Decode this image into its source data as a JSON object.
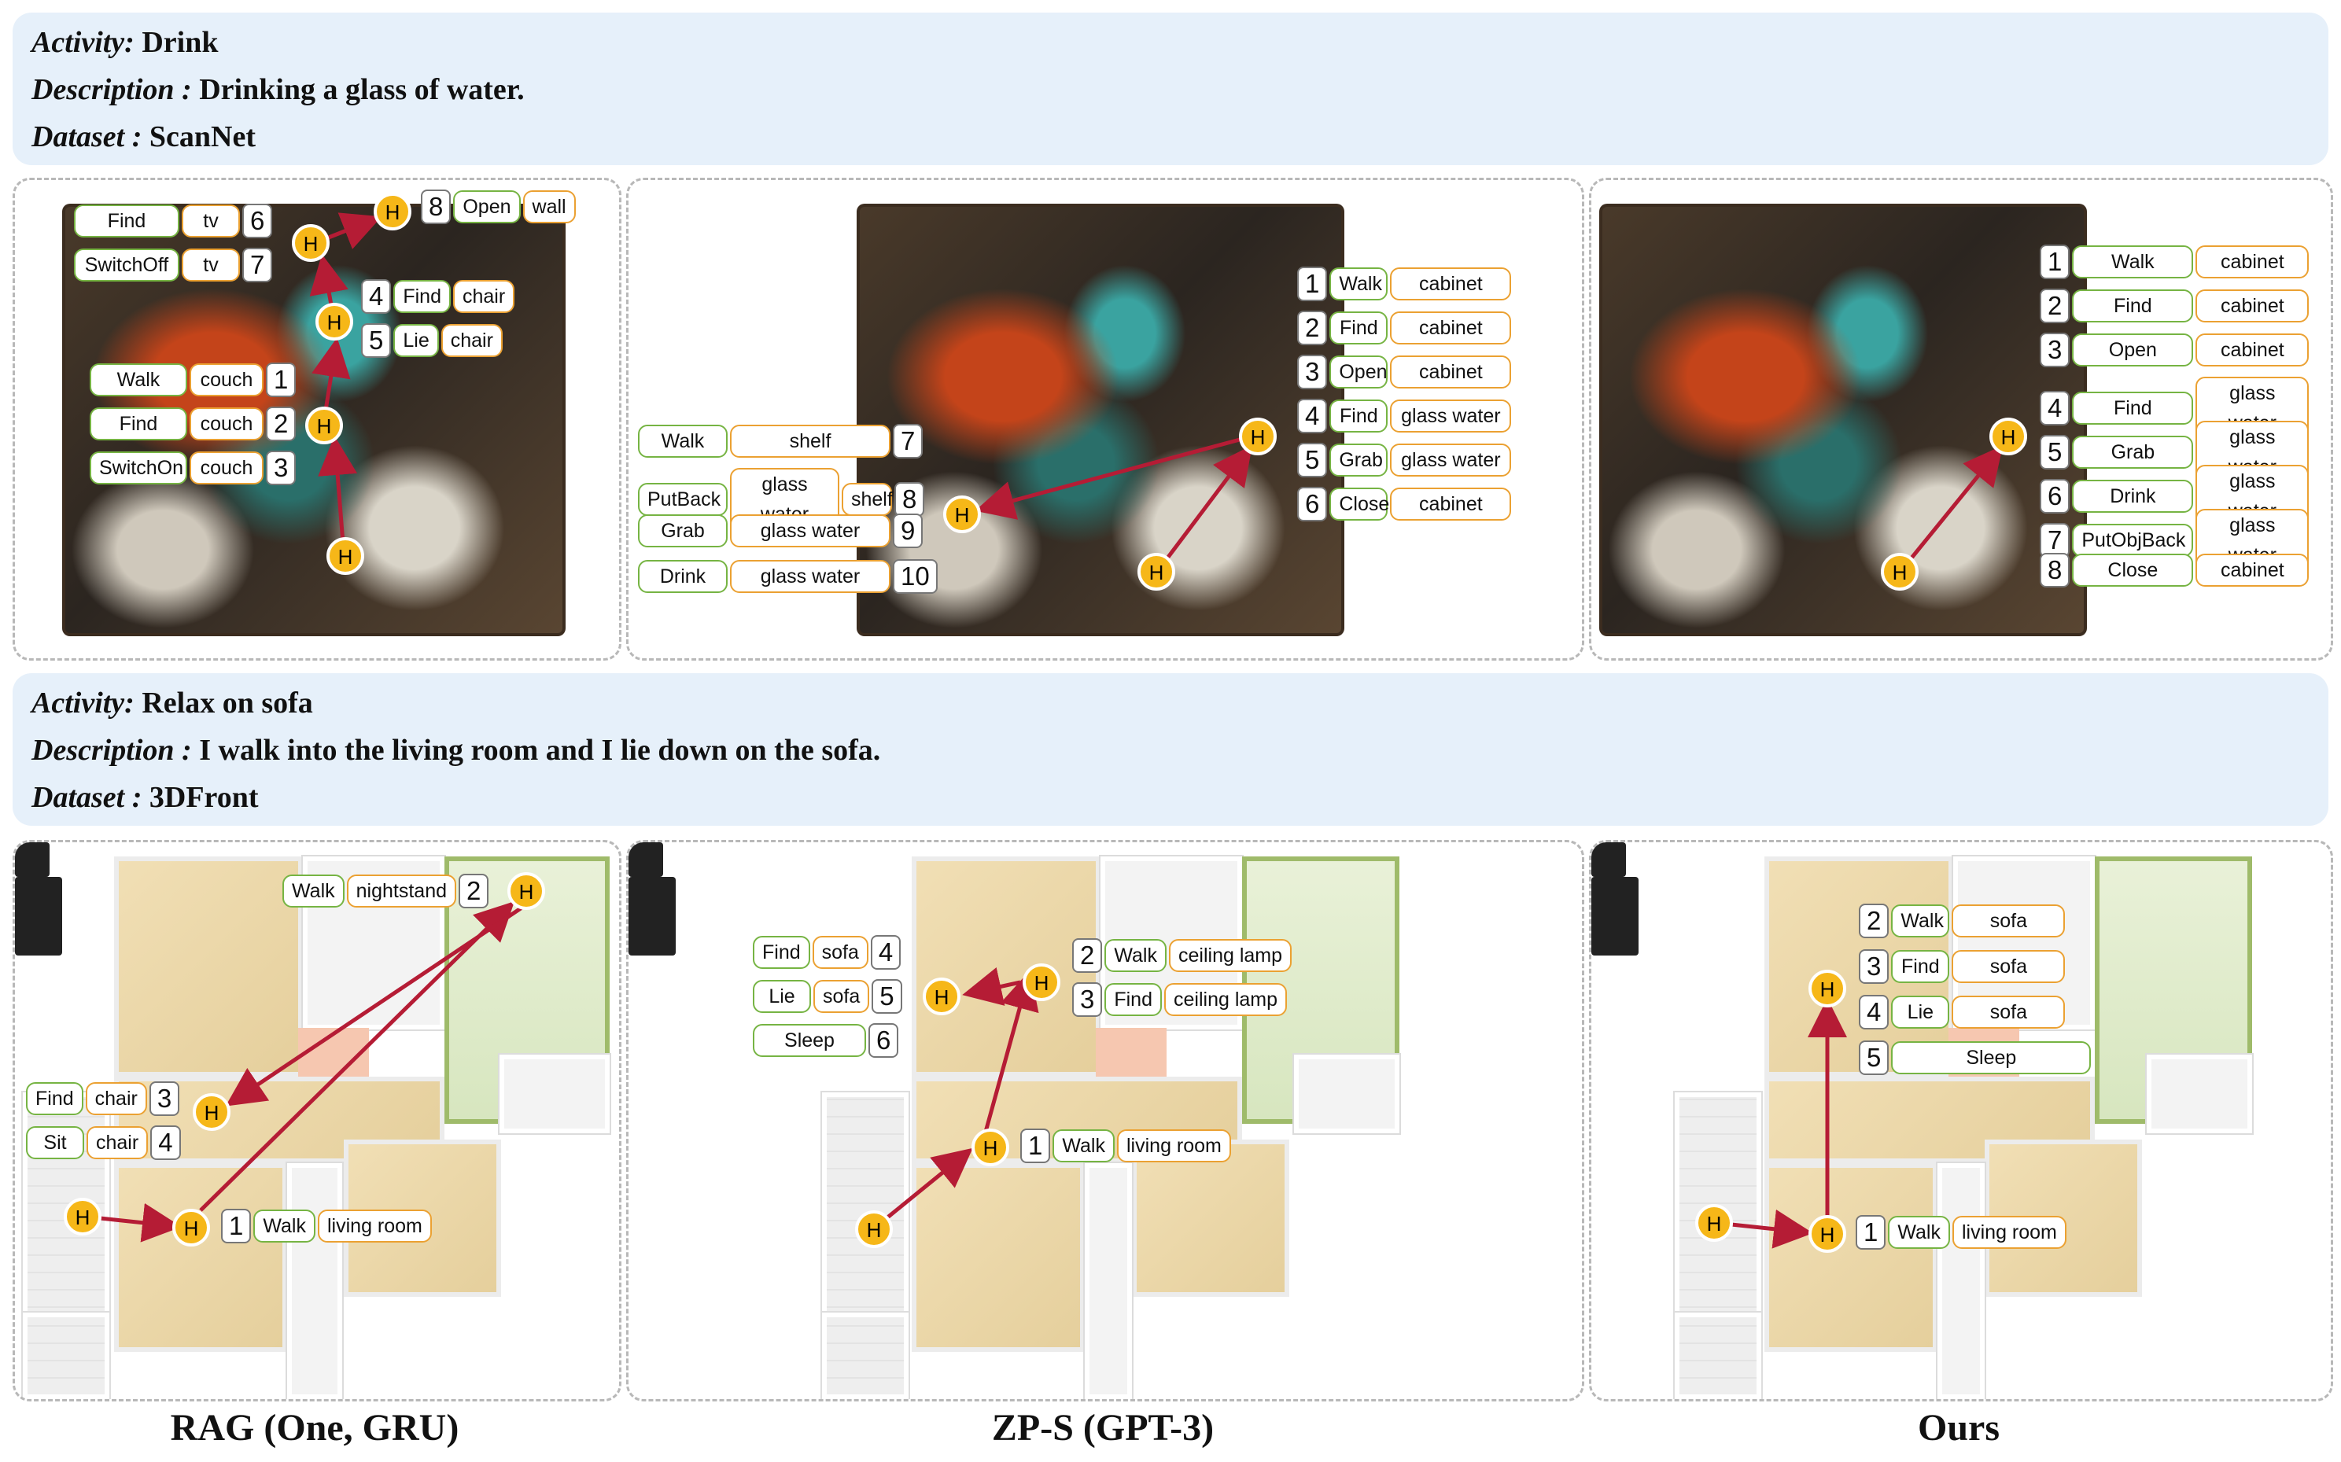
{
  "examples": [
    {
      "activity_label": "Activity:",
      "activity": "Drink",
      "description_label": "Description :",
      "description": "Drinking a glass of water.",
      "dataset_label": "Dataset :",
      "dataset": "ScanNet"
    },
    {
      "activity_label": "Activity:",
      "activity": "Relax on sofa",
      "description_label": "Description :",
      "description": "I walk into the living room and I lie down on the sofa.",
      "dataset_label": "Dataset :",
      "dataset": "3DFront"
    }
  ],
  "node_label": "H",
  "colors": {
    "arrow": "#b51c35",
    "node_fill": "#f6b718",
    "action_border": "#76b443",
    "object_border": "#eba132",
    "header_bg": "#e6f0fa"
  },
  "panels": {
    "scan_rag": {
      "steps": [
        {
          "num": "6",
          "action": "Find",
          "object": "tv"
        },
        {
          "num": "7",
          "action": "SwitchOff",
          "object": "tv"
        },
        {
          "num": "8",
          "action": "Open",
          "object": "wall"
        },
        {
          "num": "4",
          "action": "Find",
          "object": "chair"
        },
        {
          "num": "5",
          "action": "Lie",
          "object": "chair"
        },
        {
          "num": "1",
          "action": "Walk",
          "object": "couch"
        },
        {
          "num": "2",
          "action": "Find",
          "object": "couch"
        },
        {
          "num": "3",
          "action": "SwitchOn",
          "object": "couch"
        }
      ]
    },
    "scan_zps": {
      "steps": [
        {
          "num": "1",
          "action": "Walk",
          "object": "cabinet"
        },
        {
          "num": "2",
          "action": "Find",
          "object": "cabinet"
        },
        {
          "num": "3",
          "action": "Open",
          "object": "cabinet"
        },
        {
          "num": "4",
          "action": "Find",
          "object": "glass water"
        },
        {
          "num": "5",
          "action": "Grab",
          "object": "glass water"
        },
        {
          "num": "6",
          "action": "Close",
          "object": "cabinet"
        },
        {
          "num": "7",
          "action": "Walk",
          "object": "shelf"
        },
        {
          "num": "8",
          "action": "PutBack",
          "object": "glass water",
          "object2": "shelf"
        },
        {
          "num": "9",
          "action": "Grab",
          "object": "glass water"
        },
        {
          "num": "10",
          "action": "Drink",
          "object": "glass water"
        }
      ]
    },
    "scan_ours": {
      "steps": [
        {
          "num": "1",
          "action": "Walk",
          "object": "cabinet"
        },
        {
          "num": "2",
          "action": "Find",
          "object": "cabinet"
        },
        {
          "num": "3",
          "action": "Open",
          "object": "cabinet"
        },
        {
          "num": "4",
          "action": "Find",
          "object": "glass water"
        },
        {
          "num": "5",
          "action": "Grab",
          "object": "glass water"
        },
        {
          "num": "6",
          "action": "Drink",
          "object": "glass water"
        },
        {
          "num": "7",
          "action": "PutObjBack",
          "object": "glass water"
        },
        {
          "num": "8",
          "action": "Close",
          "object": "cabinet"
        }
      ]
    },
    "front_rag": {
      "steps": [
        {
          "num": "2",
          "action": "Walk",
          "object": "nightstand"
        },
        {
          "num": "3",
          "action": "Find",
          "object": "chair"
        },
        {
          "num": "4",
          "action": "Sit",
          "object": "chair"
        },
        {
          "num": "1",
          "action": "Walk",
          "object": "living room"
        }
      ]
    },
    "front_zps": {
      "steps": [
        {
          "num": "4",
          "action": "Find",
          "object": "sofa"
        },
        {
          "num": "5",
          "action": "Lie",
          "object": "sofa"
        },
        {
          "num": "6",
          "action": "Sleep",
          "object": ""
        },
        {
          "num": "2",
          "action": "Walk",
          "object": "ceiling lamp"
        },
        {
          "num": "3",
          "action": "Find",
          "object": "ceiling lamp"
        },
        {
          "num": "1",
          "action": "Walk",
          "object": "living room"
        }
      ]
    },
    "front_ours": {
      "steps": [
        {
          "num": "2",
          "action": "Walk",
          "object": "sofa"
        },
        {
          "num": "3",
          "action": "Find",
          "object": "sofa"
        },
        {
          "num": "4",
          "action": "Lie",
          "object": "sofa"
        },
        {
          "num": "5",
          "action": "Sleep",
          "object": ""
        },
        {
          "num": "1",
          "action": "Walk",
          "object": "living room"
        }
      ]
    }
  },
  "captions": [
    "RAG (One, GRU)",
    "ZP-S (GPT-3)",
    "Ours"
  ]
}
